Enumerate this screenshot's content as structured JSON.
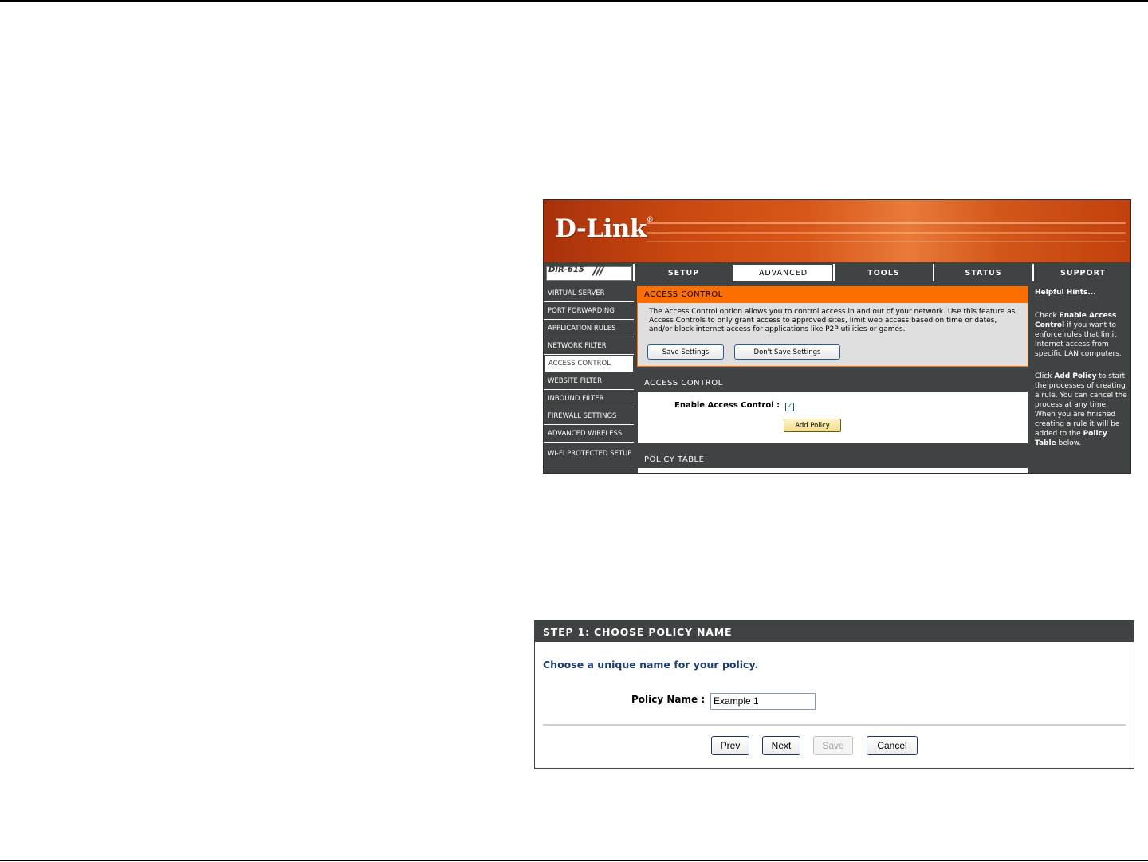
{
  "screenshot1": {
    "logo": "D-Link",
    "model": "DIR-615",
    "nav_tabs": [
      {
        "label": "SETUP"
      },
      {
        "label": "ADVANCED"
      },
      {
        "label": "TOOLS"
      },
      {
        "label": "STATUS"
      },
      {
        "label": "SUPPORT"
      }
    ],
    "active_tab": "ADVANCED",
    "sidebar": [
      {
        "label": "VIRTUAL SERVER"
      },
      {
        "label": "PORT FORWARDING"
      },
      {
        "label": "APPLICATION RULES"
      },
      {
        "label": "NETWORK FILTER"
      },
      {
        "label": "ACCESS CONTROL"
      },
      {
        "label": "WEBSITE FILTER"
      },
      {
        "label": "INBOUND FILTER"
      },
      {
        "label": "FIREWALL SETTINGS"
      },
      {
        "label": "ADVANCED WIRELESS"
      },
      {
        "label": "WI-FI PROTECTED SETUP"
      }
    ],
    "active_sidebar": "ACCESS CONTROL",
    "intro": {
      "title": "ACCESS CONTROL",
      "description": "The Access Control option allows you to control access in and out of your network. Use this feature as Access Controls to only grant access to approved sites, limit web access based on time or dates, and/or block internet access for applications like P2P utilities or games.",
      "save_label": "Save Settings",
      "dont_save_label": "Don't Save Settings"
    },
    "access_control": {
      "title": "ACCESS CONTROL",
      "enable_label": "Enable Access Control :",
      "enable_checked": true,
      "check_mark": "✓",
      "add_policy_label": "Add Policy"
    },
    "policy_table": {
      "title": "POLICY TABLE"
    },
    "hints": {
      "title": "Helpful Hints...",
      "p1_pre": "Check ",
      "p1_bold": "Enable Access Control",
      "p1_post": " if you want to enforce rules that limit Internet access from specific LAN computers.",
      "p2_pre": "Click ",
      "p2_bold": "Add Policy",
      "p2_mid": " to start the processes of creating a rule. You can cancel the process at any time. When you are finished creating a rule it will be added to the ",
      "p2_bold2": "Policy Table",
      "p2_post": " below."
    },
    "colors": {
      "orange": "#ff6f00",
      "dark_gray": "#404343"
    }
  },
  "screenshot2": {
    "header": "STEP 1: CHOOSE POLICY NAME",
    "subtitle": "Choose a unique name for your policy.",
    "policy_name_label": "Policy Name :",
    "policy_name_value": "Example 1",
    "buttons": {
      "prev": "Prev",
      "next": "Next",
      "save": "Save",
      "cancel": "Cancel"
    },
    "save_disabled": true
  }
}
